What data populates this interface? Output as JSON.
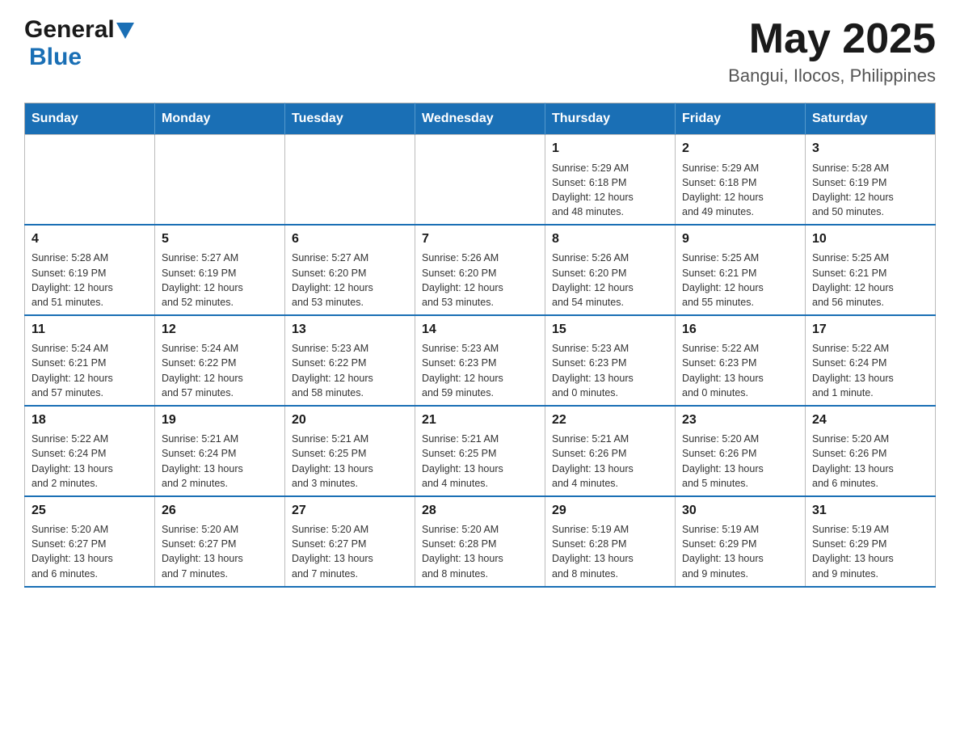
{
  "header": {
    "logo_general": "General",
    "logo_blue": "Blue",
    "month_year": "May 2025",
    "location": "Bangui, Ilocos, Philippines"
  },
  "days_of_week": [
    "Sunday",
    "Monday",
    "Tuesday",
    "Wednesday",
    "Thursday",
    "Friday",
    "Saturday"
  ],
  "weeks": [
    [
      {
        "day": "",
        "info": ""
      },
      {
        "day": "",
        "info": ""
      },
      {
        "day": "",
        "info": ""
      },
      {
        "day": "",
        "info": ""
      },
      {
        "day": "1",
        "info": "Sunrise: 5:29 AM\nSunset: 6:18 PM\nDaylight: 12 hours\nand 48 minutes."
      },
      {
        "day": "2",
        "info": "Sunrise: 5:29 AM\nSunset: 6:18 PM\nDaylight: 12 hours\nand 49 minutes."
      },
      {
        "day": "3",
        "info": "Sunrise: 5:28 AM\nSunset: 6:19 PM\nDaylight: 12 hours\nand 50 minutes."
      }
    ],
    [
      {
        "day": "4",
        "info": "Sunrise: 5:28 AM\nSunset: 6:19 PM\nDaylight: 12 hours\nand 51 minutes."
      },
      {
        "day": "5",
        "info": "Sunrise: 5:27 AM\nSunset: 6:19 PM\nDaylight: 12 hours\nand 52 minutes."
      },
      {
        "day": "6",
        "info": "Sunrise: 5:27 AM\nSunset: 6:20 PM\nDaylight: 12 hours\nand 53 minutes."
      },
      {
        "day": "7",
        "info": "Sunrise: 5:26 AM\nSunset: 6:20 PM\nDaylight: 12 hours\nand 53 minutes."
      },
      {
        "day": "8",
        "info": "Sunrise: 5:26 AM\nSunset: 6:20 PM\nDaylight: 12 hours\nand 54 minutes."
      },
      {
        "day": "9",
        "info": "Sunrise: 5:25 AM\nSunset: 6:21 PM\nDaylight: 12 hours\nand 55 minutes."
      },
      {
        "day": "10",
        "info": "Sunrise: 5:25 AM\nSunset: 6:21 PM\nDaylight: 12 hours\nand 56 minutes."
      }
    ],
    [
      {
        "day": "11",
        "info": "Sunrise: 5:24 AM\nSunset: 6:21 PM\nDaylight: 12 hours\nand 57 minutes."
      },
      {
        "day": "12",
        "info": "Sunrise: 5:24 AM\nSunset: 6:22 PM\nDaylight: 12 hours\nand 57 minutes."
      },
      {
        "day": "13",
        "info": "Sunrise: 5:23 AM\nSunset: 6:22 PM\nDaylight: 12 hours\nand 58 minutes."
      },
      {
        "day": "14",
        "info": "Sunrise: 5:23 AM\nSunset: 6:23 PM\nDaylight: 12 hours\nand 59 minutes."
      },
      {
        "day": "15",
        "info": "Sunrise: 5:23 AM\nSunset: 6:23 PM\nDaylight: 13 hours\nand 0 minutes."
      },
      {
        "day": "16",
        "info": "Sunrise: 5:22 AM\nSunset: 6:23 PM\nDaylight: 13 hours\nand 0 minutes."
      },
      {
        "day": "17",
        "info": "Sunrise: 5:22 AM\nSunset: 6:24 PM\nDaylight: 13 hours\nand 1 minute."
      }
    ],
    [
      {
        "day": "18",
        "info": "Sunrise: 5:22 AM\nSunset: 6:24 PM\nDaylight: 13 hours\nand 2 minutes."
      },
      {
        "day": "19",
        "info": "Sunrise: 5:21 AM\nSunset: 6:24 PM\nDaylight: 13 hours\nand 2 minutes."
      },
      {
        "day": "20",
        "info": "Sunrise: 5:21 AM\nSunset: 6:25 PM\nDaylight: 13 hours\nand 3 minutes."
      },
      {
        "day": "21",
        "info": "Sunrise: 5:21 AM\nSunset: 6:25 PM\nDaylight: 13 hours\nand 4 minutes."
      },
      {
        "day": "22",
        "info": "Sunrise: 5:21 AM\nSunset: 6:26 PM\nDaylight: 13 hours\nand 4 minutes."
      },
      {
        "day": "23",
        "info": "Sunrise: 5:20 AM\nSunset: 6:26 PM\nDaylight: 13 hours\nand 5 minutes."
      },
      {
        "day": "24",
        "info": "Sunrise: 5:20 AM\nSunset: 6:26 PM\nDaylight: 13 hours\nand 6 minutes."
      }
    ],
    [
      {
        "day": "25",
        "info": "Sunrise: 5:20 AM\nSunset: 6:27 PM\nDaylight: 13 hours\nand 6 minutes."
      },
      {
        "day": "26",
        "info": "Sunrise: 5:20 AM\nSunset: 6:27 PM\nDaylight: 13 hours\nand 7 minutes."
      },
      {
        "day": "27",
        "info": "Sunrise: 5:20 AM\nSunset: 6:27 PM\nDaylight: 13 hours\nand 7 minutes."
      },
      {
        "day": "28",
        "info": "Sunrise: 5:20 AM\nSunset: 6:28 PM\nDaylight: 13 hours\nand 8 minutes."
      },
      {
        "day": "29",
        "info": "Sunrise: 5:19 AM\nSunset: 6:28 PM\nDaylight: 13 hours\nand 8 minutes."
      },
      {
        "day": "30",
        "info": "Sunrise: 5:19 AM\nSunset: 6:29 PM\nDaylight: 13 hours\nand 9 minutes."
      },
      {
        "day": "31",
        "info": "Sunrise: 5:19 AM\nSunset: 6:29 PM\nDaylight: 13 hours\nand 9 minutes."
      }
    ]
  ]
}
